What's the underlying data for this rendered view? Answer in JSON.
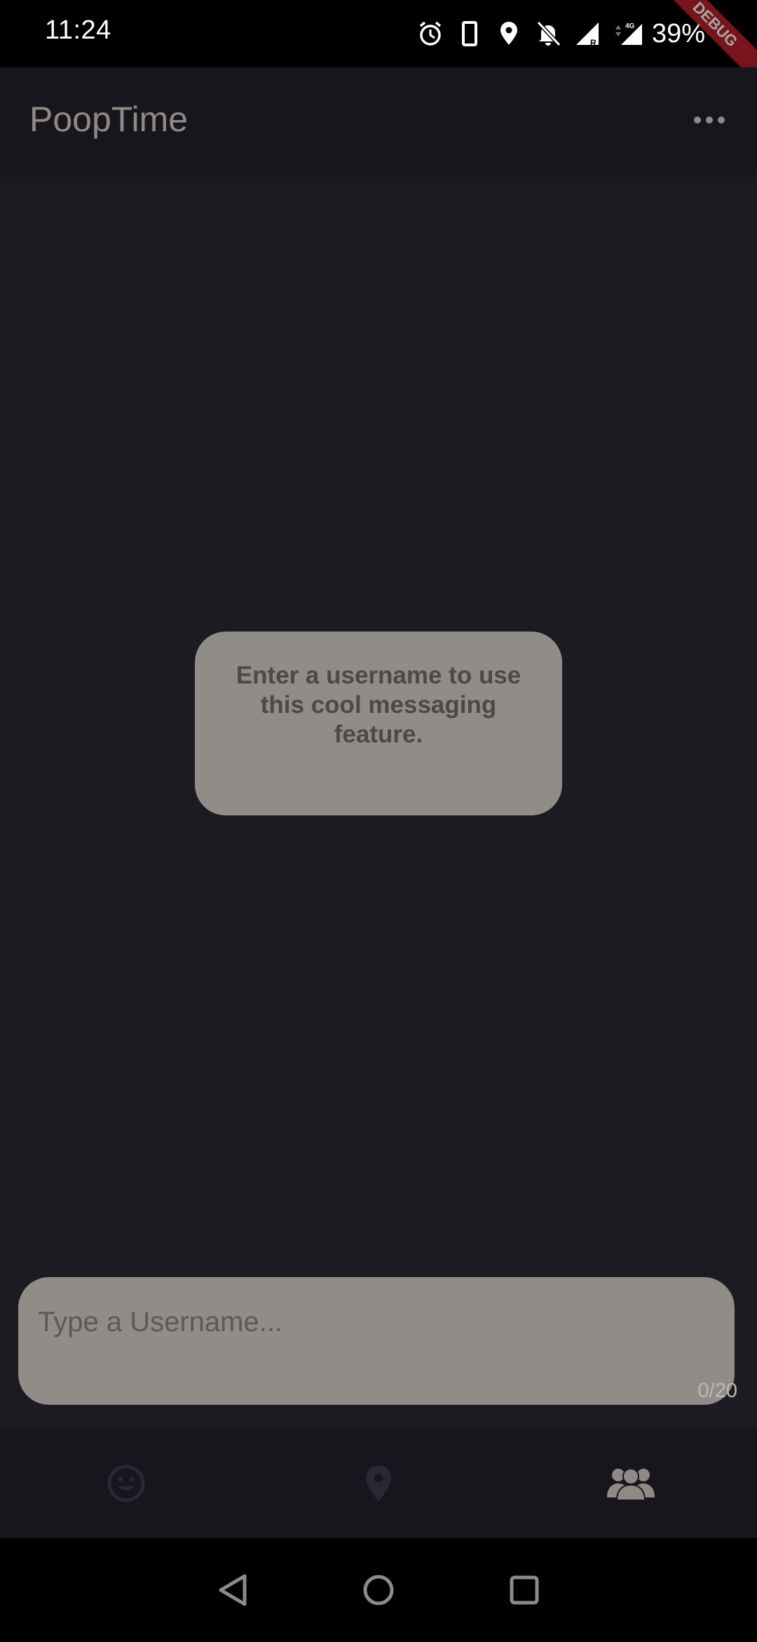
{
  "status_bar": {
    "time": "11:24",
    "battery": "39%",
    "icons": [
      "alarm-icon",
      "phone-icon",
      "location-icon",
      "bell-off-icon",
      "signal-roaming-icon",
      "signal-4g-icon"
    ],
    "debug_banner": "DEBUG"
  },
  "app_bar": {
    "title": "PoopTime",
    "menu_icon": "more-horizontal-icon"
  },
  "message": {
    "text": "Enter a username to use this cool messaging feature."
  },
  "username_input": {
    "placeholder": "Type a Username...",
    "value": "",
    "counter": "0/20"
  },
  "bottom_nav": {
    "items": [
      {
        "icon": "smiley-icon",
        "active": false
      },
      {
        "icon": "location-pin-icon",
        "active": false
      },
      {
        "icon": "users-icon",
        "active": true
      }
    ]
  },
  "system_nav": {
    "items": [
      "back-icon",
      "home-icon",
      "recents-icon"
    ]
  },
  "colors": {
    "background": "#1d1b22",
    "app_bar": "#18161c",
    "card": "#908c87",
    "title": "#8e8a85",
    "active_nav": "#8e8a85",
    "inactive_nav": "#2a2830"
  }
}
